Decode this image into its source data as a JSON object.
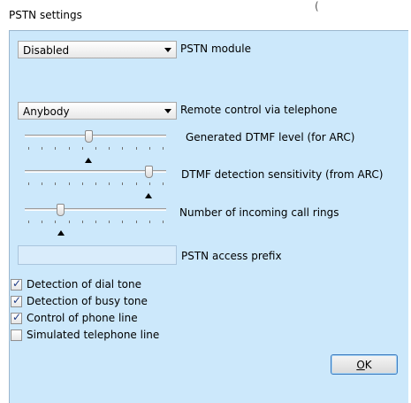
{
  "window": {
    "title": "PSTN settings",
    "title_mark": "("
  },
  "pstn_module": {
    "value": "Disabled",
    "label": "PSTN module"
  },
  "remote_control": {
    "value": "Anybody",
    "label": "Remote control via telephone"
  },
  "sliders": [
    {
      "label": "Generated DTMF level (for ARC)",
      "level": 0.45,
      "default_mark": 0.45
    },
    {
      "label": "DTMF detection sensitivity (from ARC)",
      "level": 0.9,
      "default_mark": 0.9
    },
    {
      "label": "Number of incoming call rings",
      "level": 0.24,
      "default_mark": 0.24
    }
  ],
  "access_prefix": {
    "value": "",
    "label": "PSTN access prefix"
  },
  "checkboxes": [
    {
      "label": "Detection of dial tone",
      "checked": true
    },
    {
      "label": "Detection of busy tone",
      "checked": true
    },
    {
      "label": "Control of phone line",
      "checked": true
    },
    {
      "label": "Simulated telephone line",
      "checked": false
    }
  ],
  "ok_button": {
    "label": "OK",
    "mnemonic": "O",
    "rest": "K"
  },
  "colors": {
    "panel": "#cce8fb",
    "accent": "#3d7bbf"
  }
}
